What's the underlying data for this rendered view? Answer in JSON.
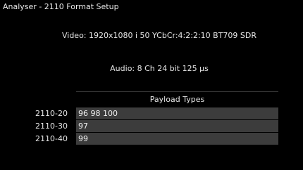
{
  "window": {
    "title": "Analyser - 2110 Format Setup"
  },
  "format": {
    "video": "Video: 1920x1080 i 50 YCbCr:4:2:2:10 BT709 SDR",
    "audio": "Audio: 8 Ch 24 bit 125 µs"
  },
  "payload": {
    "header": "Payload Types",
    "rows": [
      {
        "label": "2110-20",
        "value": "96 98 100"
      },
      {
        "label": "2110-30",
        "value": "97"
      },
      {
        "label": "2110-40",
        "value": "99"
      }
    ]
  },
  "colors": {
    "background": "#000000",
    "field_background": "#3c3c3c",
    "text": "#e6e6e6"
  }
}
